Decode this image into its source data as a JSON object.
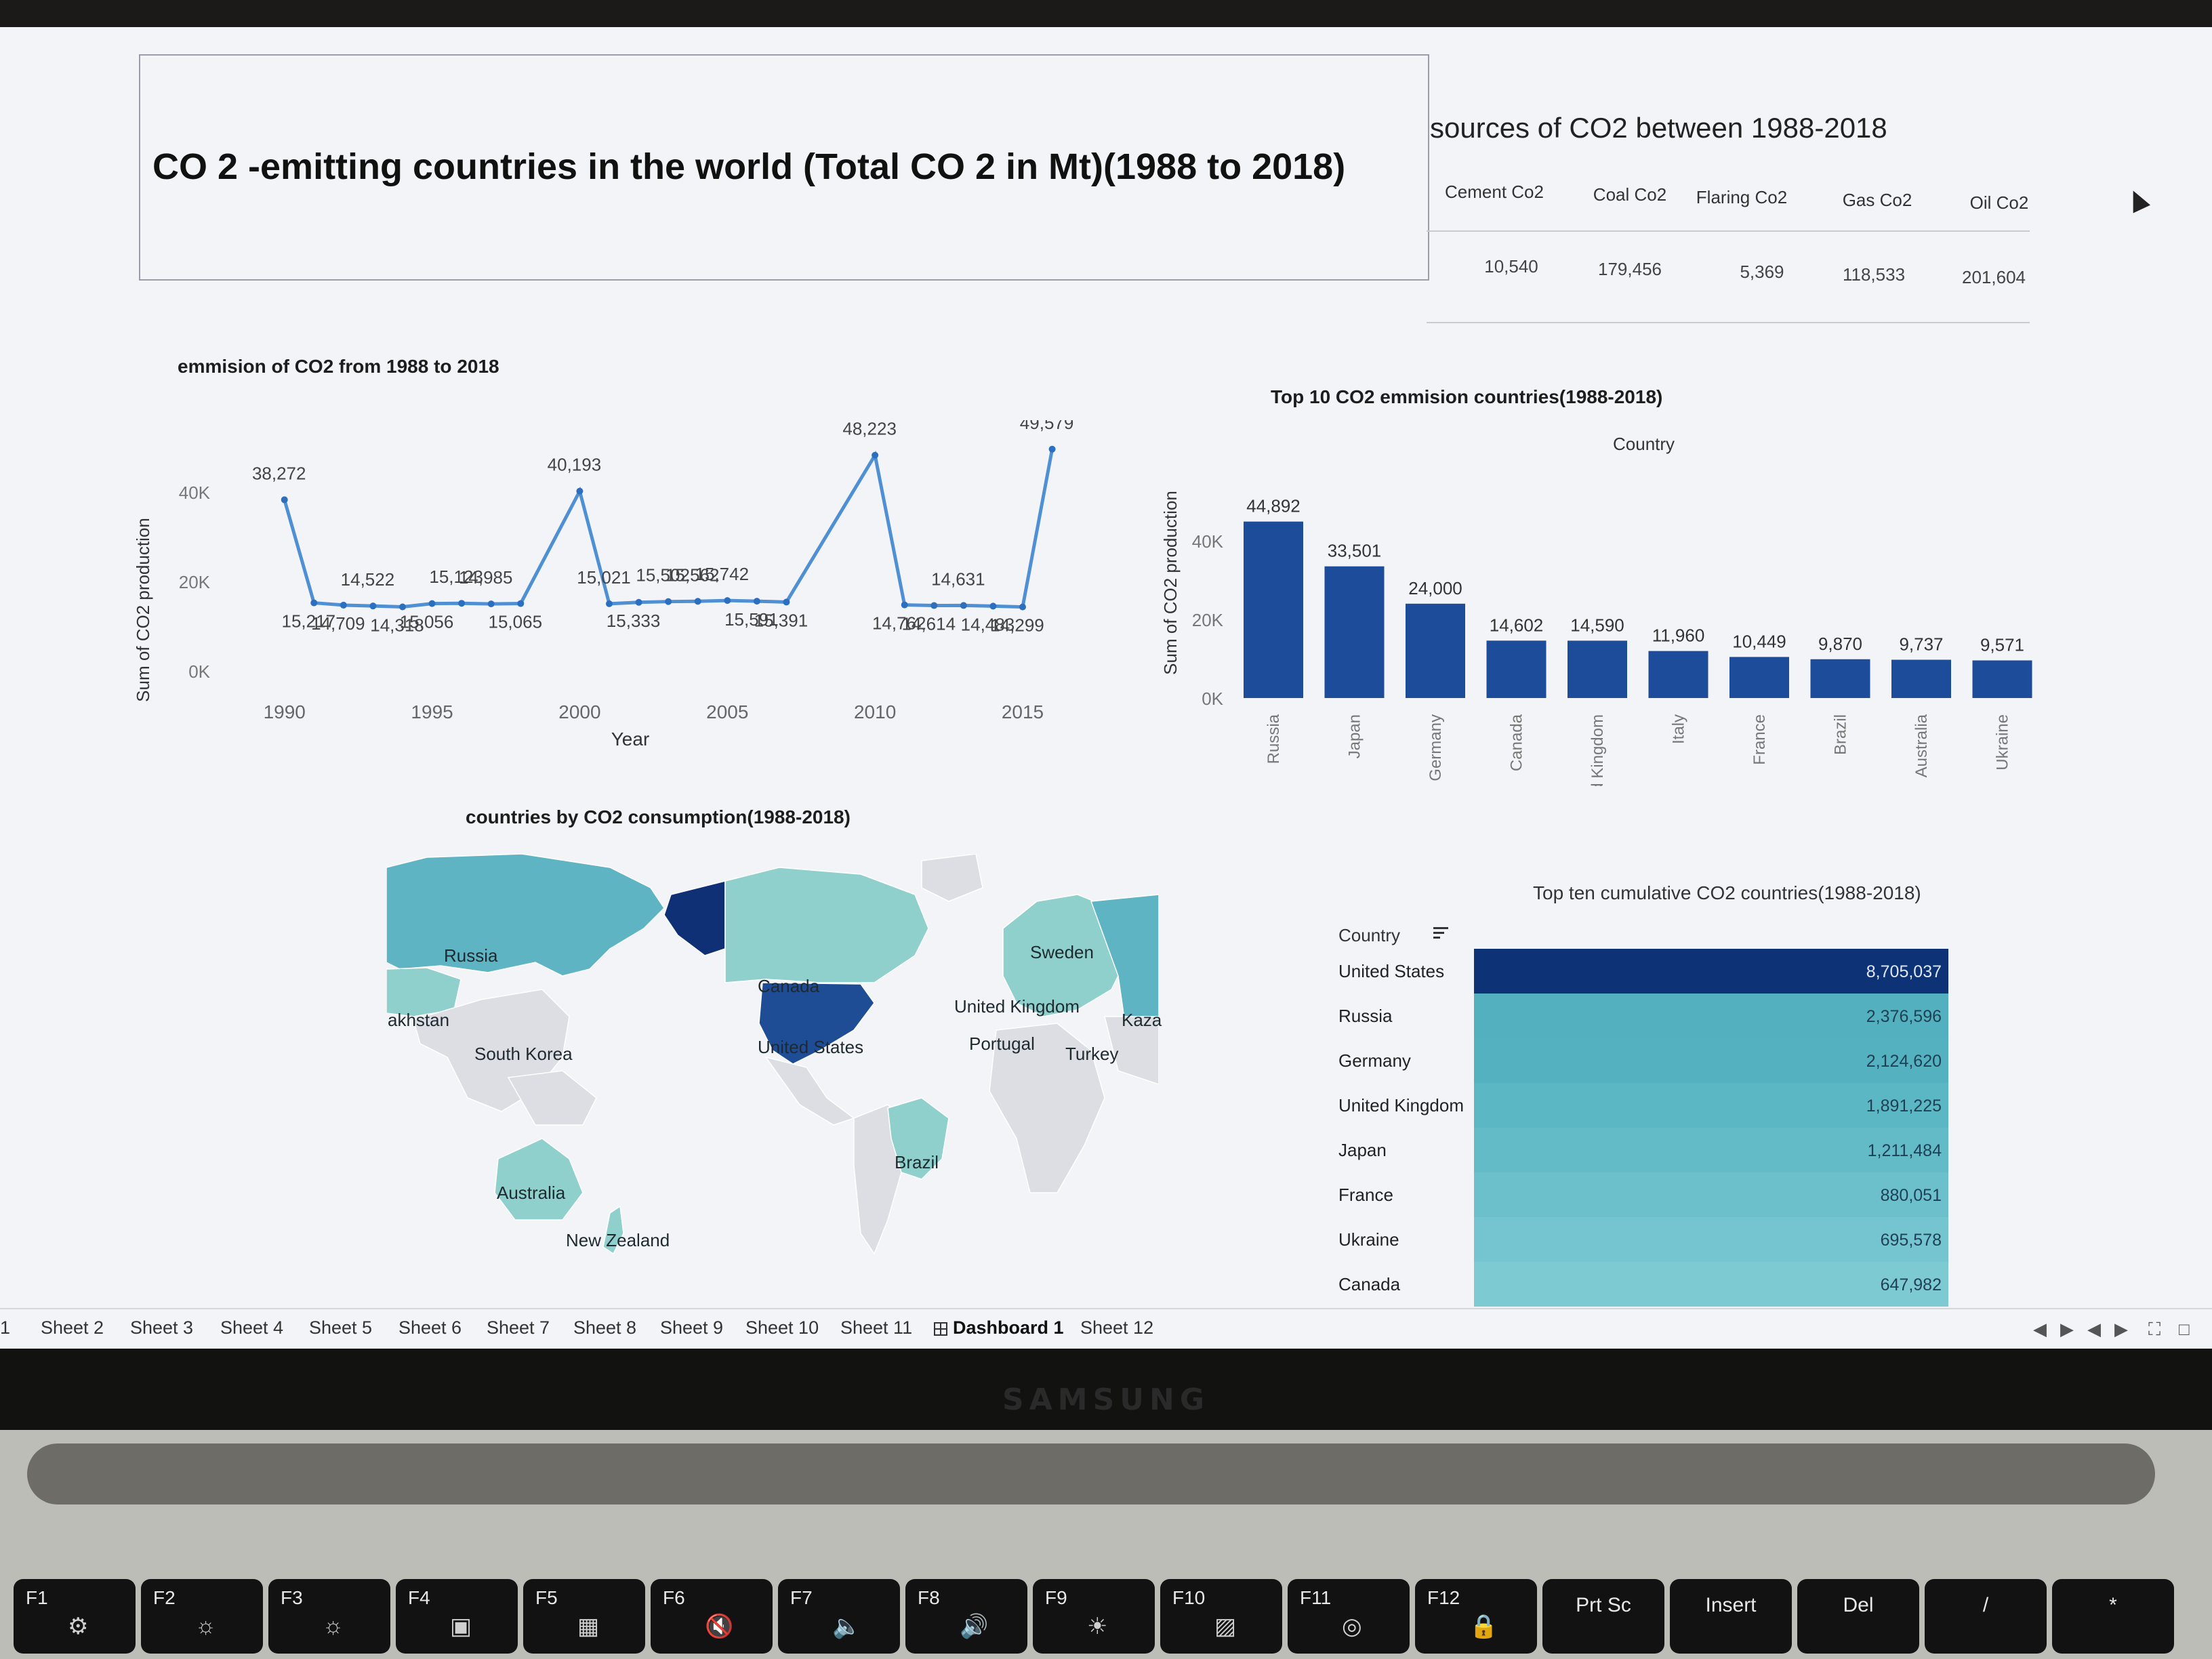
{
  "dashboard": {
    "title": "CO 2 -emitting countries in the world (Total CO 2 in Mt)(1988 to 2018)"
  },
  "sources": {
    "title": "sources of CO2 between 1988-2018",
    "columns": [
      "Cement Co2",
      "Coal Co2",
      "Flaring Co2",
      "Gas Co2",
      "Oil Co2"
    ],
    "values": [
      "10,540",
      "179,456",
      "5,369",
      "118,533",
      "201,604"
    ]
  },
  "line_panel": {
    "title": "emmision of CO2 from 1988 to 2018"
  },
  "bar_panel": {
    "title": "Top 10 CO2 emmision countries(1988-2018)",
    "header": "Country"
  },
  "map_panel": {
    "title": "countries by CO2 consumption(1988-2018)",
    "labels": [
      "Russia",
      "akhstan",
      "South Korea",
      "Canada",
      "United States",
      "Sweden",
      "United Kingdom",
      "Kaza",
      "Portugal",
      "Turkey",
      "Brazil",
      "Australia",
      "New Zealand"
    ],
    "colors": {
      "light": "#8fcfcc",
      "mid": "#5fb4c4",
      "dark": "#1e4d96",
      "darkest": "#0f3074",
      "none": "#dcdee3"
    }
  },
  "table_panel": {
    "title": "Top ten cumulative CO2 countries(1988-2018)",
    "header": "Country"
  },
  "tabs": [
    "1",
    "Sheet 2",
    "Sheet 3",
    "Sheet 4",
    "Sheet 5",
    "Sheet 6",
    "Sheet 7",
    "Sheet 8",
    "Sheet 9",
    "Sheet 10",
    "Sheet 11",
    "Dashboard 1",
    "Sheet 12"
  ],
  "active_tab": "Dashboard 1",
  "laptop": {
    "brand": "SAMSUNG",
    "keys": [
      "F1",
      "F2",
      "F3",
      "F4",
      "F5",
      "F6",
      "F7",
      "F8",
      "F9",
      "F10",
      "F11",
      "F12",
      "Prt Sc",
      "Insert",
      "Del",
      "/",
      "*"
    ]
  },
  "chart_data": [
    {
      "type": "line",
      "title": "emmision of CO2 from 1988 to 2018",
      "xlabel": "Year",
      "ylabel": "Sum of CO2 production",
      "yticks": [
        "0K",
        "20K",
        "40K"
      ],
      "xticks": [
        "1990",
        "1995",
        "2000",
        "2005",
        "2010",
        "2015"
      ],
      "ylim": [
        0,
        50000
      ],
      "x": [
        1990,
        1991,
        1992,
        1993,
        1994,
        1995,
        1996,
        1997,
        1998,
        1999,
        2000,
        2001,
        2002,
        2003,
        2004,
        2005,
        2006,
        2007,
        2008,
        2009,
        2010,
        2011,
        2012,
        2013,
        2014,
        2015,
        2016
      ],
      "y": [
        38272,
        15217,
        14709,
        14522,
        14318,
        15056,
        15123,
        14985,
        15065,
        40193,
        15021,
        15333,
        15502,
        15562,
        15742,
        15591,
        15391,
        48223,
        14762,
        14614,
        14631,
        14483,
        14299,
        49579
      ],
      "labels": [
        "38,272",
        "15,217",
        "14,709",
        "14,522",
        "14,318",
        "15,056",
        "15,123",
        "14,985",
        "15,065",
        "40,193",
        "15,021",
        "15,333",
        "15,502",
        "15,562",
        "15,742",
        "15,591",
        "15,391",
        "48,223",
        "14,762",
        "14,614",
        "14,631",
        "14,483",
        "14,299",
        "49,579"
      ],
      "points_x": [
        1990,
        1991,
        1992,
        1993,
        1994,
        1995,
        1996,
        1997,
        1998,
        2000,
        2001,
        2002,
        2003,
        2004,
        2005,
        2006,
        2007,
        2010,
        2011,
        2012,
        2013,
        2014,
        2015,
        2016
      ]
    },
    {
      "type": "bar",
      "title": "Top 10 CO2 emmision countries(1988-2018)",
      "ylabel": "Sum of CO2 production",
      "yticks": [
        "0K",
        "20K",
        "40K"
      ],
      "ylim": [
        0,
        50000
      ],
      "categories": [
        "Russia",
        "Japan",
        "Germany",
        "Canada",
        "United Kingdom",
        "Italy",
        "France",
        "Brazil",
        "Australia",
        "Ukraine"
      ],
      "values": [
        44892,
        33501,
        24000,
        14602,
        14590,
        11960,
        10449,
        9870,
        9737,
        9571
      ],
      "labels": [
        "44,892",
        "33,501",
        "24,000",
        "14,602",
        "14,590",
        "11,960",
        "10,449",
        "9,870",
        "9,737",
        "9,571"
      ],
      "color": "#1d4d9a"
    },
    {
      "type": "bar",
      "title": "Top ten cumulative CO2 countries(1988-2018)",
      "categories": [
        "United States",
        "Russia",
        "Germany",
        "United Kingdom",
        "Japan",
        "France",
        "Ukraine",
        "Canada"
      ],
      "values": [
        8705037,
        2376596,
        2124620,
        1891225,
        1211484,
        880051,
        695578,
        647982
      ],
      "labels": [
        "8,705,037",
        "2,376,596",
        "2,124,620",
        "1,891,225",
        "1,211,484",
        "880,051",
        "695,578",
        "647,982"
      ],
      "colors": [
        "#0d3275",
        "#52b0bf",
        "#54b2c0",
        "#5bb7c4",
        "#62bbc7",
        "#6bc0cb",
        "#74c5cf",
        "#7ecad2"
      ]
    }
  ]
}
